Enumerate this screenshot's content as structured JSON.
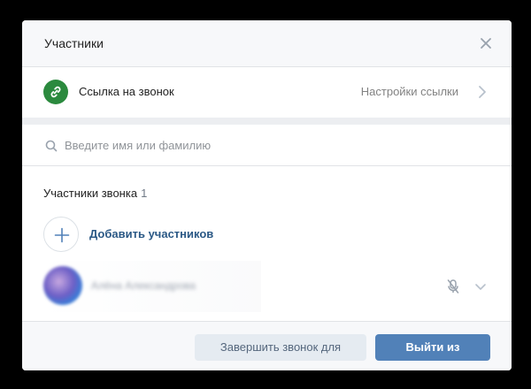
{
  "modal": {
    "title": "Участники"
  },
  "link_row": {
    "label": "Ссылка на звонок",
    "settings_label": "Настройки ссылки",
    "icon_color": "#2b8a3e"
  },
  "search": {
    "placeholder": "Введите имя или фамилию",
    "value": ""
  },
  "participants_section": {
    "title": "Участники звонка",
    "count": "1"
  },
  "add_participants": {
    "label": "Добавить участников"
  },
  "participants": [
    {
      "name": "Алёна Александрова",
      "mic": "muted"
    }
  ],
  "footer": {
    "end_for_all_label": "Завершить звонок для всех",
    "leave_label": "Выйти из звонка"
  },
  "colors": {
    "accent": "#5181b8",
    "link_text": "#2a5885",
    "secondary_button_bg": "#e5ebf1"
  }
}
